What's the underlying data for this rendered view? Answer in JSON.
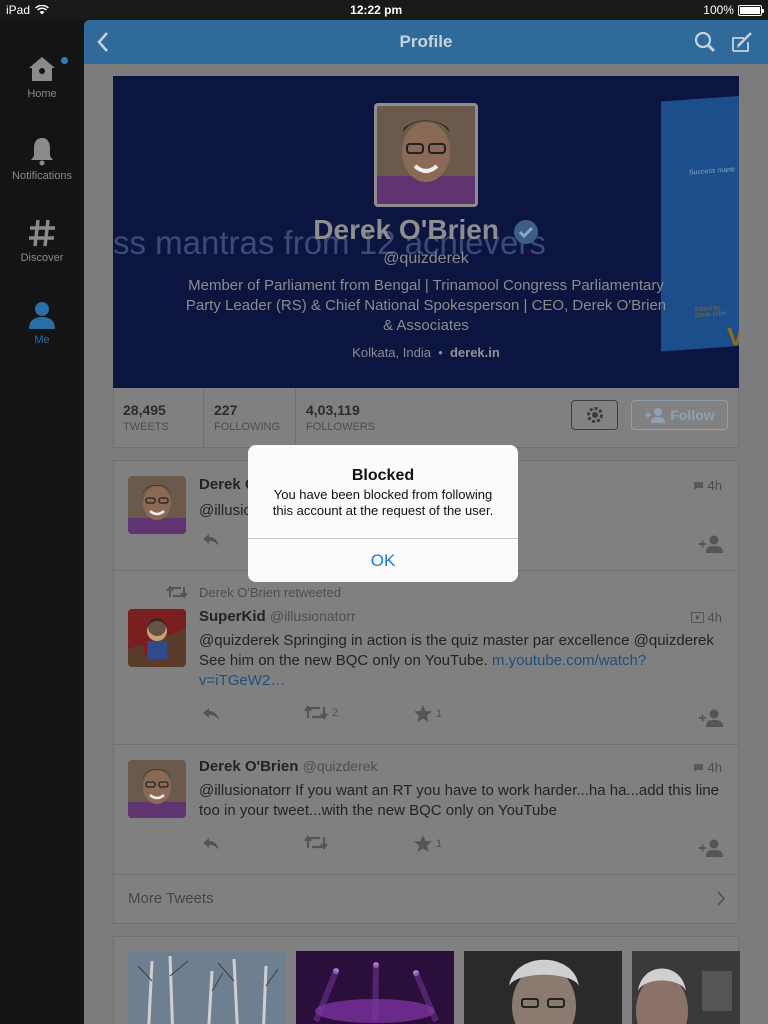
{
  "status_bar": {
    "device": "iPad",
    "time": "12:22 pm",
    "battery": "100%"
  },
  "sidebar": {
    "items": [
      {
        "label": "Home",
        "icon": "home-icon"
      },
      {
        "label": "Notifications",
        "icon": "bell-icon"
      },
      {
        "label": "Discover",
        "icon": "hashtag-icon"
      },
      {
        "label": "Me",
        "icon": "person-icon",
        "active": true
      }
    ]
  },
  "navbar": {
    "title": "Profile"
  },
  "profile": {
    "name": "Derek O'Brien",
    "handle": "@quizderek",
    "bio": "Member of Parliament from Bengal | Trinamool Congress Parliamentary Party Leader (RS) & Chief National Spokesperson | CEO, Derek O'Brien & Associates",
    "location": "Kolkata, India",
    "url": "derek.in",
    "header_text": "ss mantras from 12 achievers",
    "book_title": "Success mantr",
    "book_edited": "Edited by",
    "book_author": "Derek O'Bri",
    "book_letter": "V"
  },
  "stats": [
    {
      "value": "28,495",
      "label": "TWEETS"
    },
    {
      "value": "227",
      "label": "FOLLOWING"
    },
    {
      "value": "4,03,119",
      "label": "FOLLOWERS"
    }
  ],
  "follow_button": {
    "label": "Follow"
  },
  "tweets": [
    {
      "name": "Derek O'Brien",
      "user": "",
      "time": "4h",
      "text": "@illusionatorr ... u",
      "retweeted_by": ""
    },
    {
      "name": "SuperKid",
      "user": "@illusionatorr",
      "time": "4h",
      "text": "@quizderek Springing in action is the quiz master par excellence @quizderek See him on the new BQC only on YouTube.",
      "link": "m.youtube.com/watch?v=iTGeW2…",
      "retweeted_by": "Derek O'Brien retweeted",
      "retweets": "2",
      "favorites": "1"
    },
    {
      "name": "Derek O'Brien",
      "user": "@quizderek",
      "time": "4h",
      "text": "@illusionatorr If you want an RT you have to work harder...ha ha...add this line too in your tweet...with the new BQC only on YouTube",
      "retweets": "",
      "favorites": "1"
    }
  ],
  "more_tweets": "More Tweets",
  "dialog": {
    "title": "Blocked",
    "message": "You have been blocked from following this account at the request of the user.",
    "ok_label": "OK"
  },
  "colors": {
    "accent": "#1a7ae3",
    "navbar": "#2f6a9a",
    "dim": "#7f7f7f"
  }
}
